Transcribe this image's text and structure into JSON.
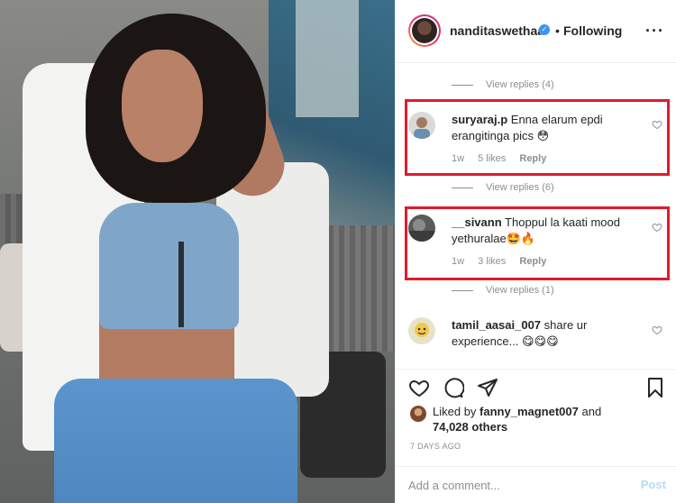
{
  "post": {
    "header": {
      "username": "nanditaswethaa",
      "verified_icon": "verified-badge-icon",
      "separator": "•",
      "follow_status": "Following",
      "more_icon": "more-options-icon"
    },
    "view_replies": [
      {
        "label": "View replies (4)"
      },
      {
        "label": "View replies (6)"
      },
      {
        "label": "View replies (1)"
      }
    ],
    "comments": [
      {
        "username": "suryaraj.p",
        "text": "Enna elarum epdi erangitinga pics 😳",
        "age": "1w",
        "likes": "5 likes",
        "reply": "Reply"
      },
      {
        "username": "__sivann",
        "text": "Thoppul la kaati mood yethuralae🤩🔥",
        "age": "1w",
        "likes": "3 likes",
        "reply": "Reply"
      },
      {
        "username": "tamil_aasai_007",
        "text": "share ur experience... 😋😋😋"
      }
    ],
    "likes": {
      "prefix": "Liked by",
      "user": "fanny_magnet007",
      "connector": "and",
      "count": "74,028 others"
    },
    "timestamp": "7 DAYS AGO",
    "add_comment": {
      "placeholder": "Add a comment...",
      "post_label": "Post"
    }
  },
  "colors": {
    "highlight": "#e01b2a",
    "verified": "#3897f0",
    "muted": "#8e8e8e",
    "post_disabled": "#b3dbff"
  }
}
